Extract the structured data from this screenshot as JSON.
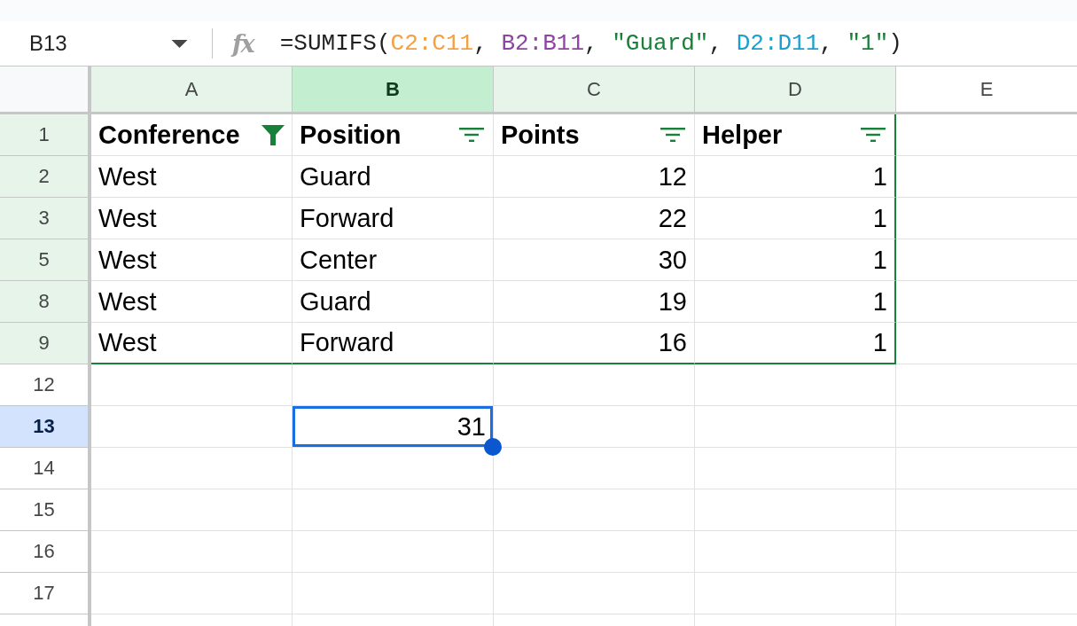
{
  "name_box": {
    "value": "B13"
  },
  "formula_bar": {
    "fx_label": "fx",
    "tokens": [
      {
        "text": "=SUMIFS(",
        "color": "#1f1f1f"
      },
      {
        "text": "C2:C11",
        "color": "#f4a040"
      },
      {
        "text": ", ",
        "color": "#1f1f1f"
      },
      {
        "text": "B2:B11",
        "color": "#8e44a0"
      },
      {
        "text": ", ",
        "color": "#1f1f1f"
      },
      {
        "text": "\"Guard\"",
        "color": "#188038"
      },
      {
        "text": ", ",
        "color": "#1f1f1f"
      },
      {
        "text": "D2:D11",
        "color": "#1aa0d0"
      },
      {
        "text": ", ",
        "color": "#1f1f1f"
      },
      {
        "text": "\"1\"",
        "color": "#188038"
      },
      {
        "text": ")",
        "color": "#1f1f1f"
      }
    ]
  },
  "grid": {
    "columns": [
      {
        "letter": "A",
        "selected": false,
        "in_filter": true
      },
      {
        "letter": "B",
        "selected": true,
        "in_filter": true
      },
      {
        "letter": "C",
        "selected": false,
        "in_filter": true
      },
      {
        "letter": "D",
        "selected": false,
        "in_filter": true
      },
      {
        "letter": "E",
        "selected": false,
        "in_filter": false
      }
    ],
    "rows": [
      {
        "number": "1",
        "selected": false,
        "in_filter": true,
        "cells": [
          {
            "kind": "header",
            "text": "Conference",
            "filter_active": true,
            "selected": false
          },
          {
            "kind": "header",
            "text": "Position",
            "filter_active": false,
            "selected": false
          },
          {
            "kind": "header",
            "text": "Points",
            "filter_active": false,
            "selected": false
          },
          {
            "kind": "header",
            "text": "Helper",
            "filter_active": false,
            "selected": false
          }
        ]
      },
      {
        "number": "2",
        "selected": false,
        "in_filter": true,
        "cells": [
          {
            "kind": "text",
            "text": "West",
            "selected": false
          },
          {
            "kind": "text",
            "text": "Guard",
            "selected": false
          },
          {
            "kind": "number",
            "text": "12",
            "selected": false
          },
          {
            "kind": "number",
            "text": "1",
            "selected": false
          }
        ]
      },
      {
        "number": "3",
        "selected": false,
        "in_filter": true,
        "cells": [
          {
            "kind": "text",
            "text": "West",
            "selected": false
          },
          {
            "kind": "text",
            "text": "Forward",
            "selected": false
          },
          {
            "kind": "number",
            "text": "22",
            "selected": false
          },
          {
            "kind": "number",
            "text": "1",
            "selected": false
          }
        ]
      },
      {
        "number": "5",
        "selected": false,
        "in_filter": true,
        "cells": [
          {
            "kind": "text",
            "text": "West",
            "selected": false
          },
          {
            "kind": "text",
            "text": "Center",
            "selected": false
          },
          {
            "kind": "number",
            "text": "30",
            "selected": false
          },
          {
            "kind": "number",
            "text": "1",
            "selected": false
          }
        ]
      },
      {
        "number": "8",
        "selected": false,
        "in_filter": true,
        "cells": [
          {
            "kind": "text",
            "text": "West",
            "selected": false
          },
          {
            "kind": "text",
            "text": "Guard",
            "selected": false
          },
          {
            "kind": "number",
            "text": "19",
            "selected": false
          },
          {
            "kind": "number",
            "text": "1",
            "selected": false
          }
        ]
      },
      {
        "number": "9",
        "selected": false,
        "in_filter": true,
        "cells": [
          {
            "kind": "text",
            "text": "West",
            "selected": false
          },
          {
            "kind": "text",
            "text": "Forward",
            "selected": false
          },
          {
            "kind": "number",
            "text": "16",
            "selected": false
          },
          {
            "kind": "number",
            "text": "1",
            "selected": false
          }
        ]
      },
      {
        "number": "12",
        "selected": false,
        "in_filter": false
      },
      {
        "number": "13",
        "selected": true,
        "in_filter": false,
        "cells": [
          null,
          {
            "kind": "number",
            "text": "31",
            "selected": true
          }
        ]
      },
      {
        "number": "14",
        "selected": false,
        "in_filter": false
      },
      {
        "number": "15",
        "selected": false,
        "in_filter": false
      },
      {
        "number": "16",
        "selected": false,
        "in_filter": false
      },
      {
        "number": "17",
        "selected": false,
        "in_filter": false
      }
    ]
  }
}
